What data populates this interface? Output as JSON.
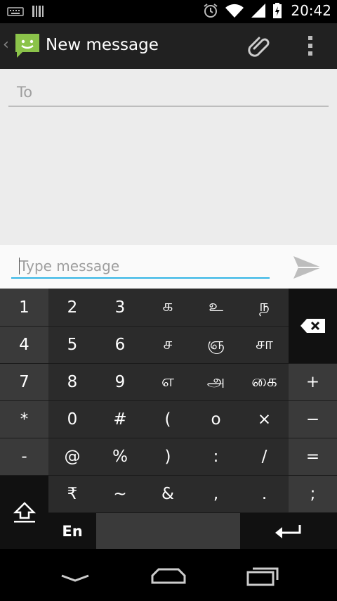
{
  "status_bar": {
    "time": "20:42",
    "icons": [
      "keyboard-icon",
      "barcode-icon",
      "alarm-icon",
      "wifi-icon",
      "signal-icon",
      "battery-charging-icon"
    ]
  },
  "action_bar": {
    "title": "New message",
    "icons": [
      "app-icon",
      "paperclip-icon",
      "overflow-menu-icon"
    ]
  },
  "compose": {
    "to_placeholder": "To",
    "message_placeholder": "Type message"
  },
  "keyboard": {
    "rows": [
      [
        "1",
        "2",
        "3",
        "க",
        "உ",
        "ந"
      ],
      [
        "4",
        "5",
        "6",
        "ச",
        "ஞ",
        "சா"
      ],
      [
        "7",
        "8",
        "9",
        "எ",
        "அ",
        "கை",
        "+"
      ],
      [
        "*",
        "0",
        "#",
        "(",
        "o",
        "×",
        "−"
      ],
      [
        "-",
        "@",
        "%",
        ")",
        ":",
        "/",
        "="
      ],
      [
        "₹",
        "~",
        "&",
        ",",
        ".",
        ";"
      ]
    ],
    "language_key": "En",
    "special_icons": [
      "backspace-icon",
      "shift-icon",
      "enter-icon"
    ]
  },
  "nav_bar": {
    "icons": [
      "back-icon",
      "home-icon",
      "recent-apps-icon"
    ]
  },
  "colors": {
    "accent": "#33b5e5",
    "app_icon_green": "#8bc34a",
    "action_bar": "#212121"
  }
}
